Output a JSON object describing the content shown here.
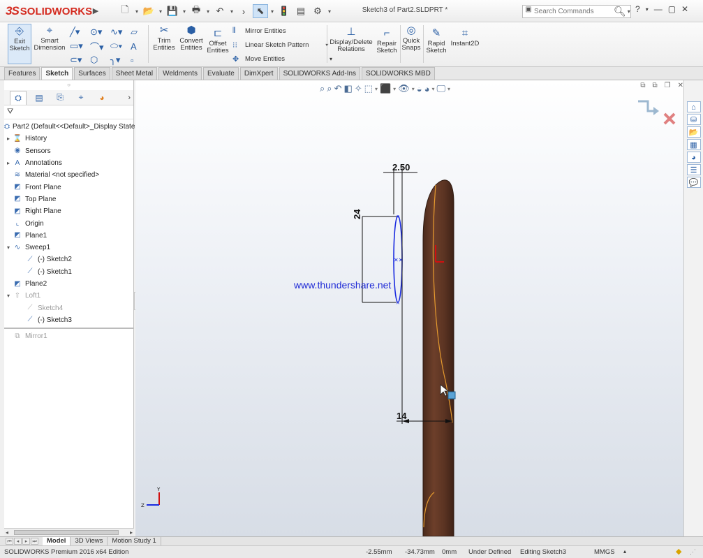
{
  "app": {
    "brand_ds": "3S",
    "brand_name": "SOLIDWORKS",
    "document_title": "Sketch3 of Part2.SLDPRT *",
    "search_placeholder": "Search Commands"
  },
  "command_manager": {
    "exit_sketch": [
      "Exit",
      "Sketch"
    ],
    "smart_dimension": [
      "Smart",
      "Dimension"
    ],
    "trim_entities": [
      "Trim",
      "Entities"
    ],
    "convert_entities": [
      "Convert",
      "Entities"
    ],
    "offset_entities": [
      "Offset",
      "Entities"
    ],
    "mirror_entities": "Mirror Entities",
    "linear_sketch_pattern": "Linear Sketch Pattern",
    "move_entities": "Move Entities",
    "display_delete_relations": [
      "Display/Delete",
      "Relations"
    ],
    "repair_sketch": [
      "Repair",
      "Sketch"
    ],
    "quick_snaps": [
      "Quick",
      "Snaps"
    ],
    "rapid_sketch": [
      "Rapid",
      "Sketch"
    ],
    "instant2d": "Instant2D"
  },
  "tabs": [
    "Features",
    "Sketch",
    "Surfaces",
    "Sheet Metal",
    "Weldments",
    "Evaluate",
    "DimXpert",
    "SOLIDWORKS Add-Ins",
    "SOLIDWORKS MBD"
  ],
  "active_tab": "Sketch",
  "feature_tree": {
    "root": "Part2  (Default<<Default>_Display State",
    "nodes": [
      {
        "label": "History",
        "icon": "history-icon",
        "expander": "▸",
        "indent": 0,
        "dim": false
      },
      {
        "label": "Sensors",
        "icon": "sensors-icon",
        "expander": "",
        "indent": 0,
        "dim": false
      },
      {
        "label": "Annotations",
        "icon": "annotations-icon",
        "expander": "▸",
        "indent": 0,
        "dim": false
      },
      {
        "label": "Material <not specified>",
        "icon": "material-icon",
        "expander": "",
        "indent": 0,
        "dim": false
      },
      {
        "label": "Front Plane",
        "icon": "plane-icon",
        "expander": "",
        "indent": 0,
        "dim": false
      },
      {
        "label": "Top Plane",
        "icon": "plane-icon",
        "expander": "",
        "indent": 0,
        "dim": false
      },
      {
        "label": "Right Plane",
        "icon": "plane-icon",
        "expander": "",
        "indent": 0,
        "dim": false
      },
      {
        "label": "Origin",
        "icon": "origin-icon",
        "expander": "",
        "indent": 0,
        "dim": false
      },
      {
        "label": "Plane1",
        "icon": "plane-icon",
        "expander": "",
        "indent": 0,
        "dim": false
      },
      {
        "label": "Sweep1",
        "icon": "sweep-icon",
        "expander": "▾",
        "indent": 0,
        "dim": false
      },
      {
        "label": "(-) Sketch2",
        "icon": "sketch-icon",
        "expander": "",
        "indent": 1,
        "dim": false
      },
      {
        "label": "(-) Sketch1",
        "icon": "sketch-icon",
        "expander": "",
        "indent": 1,
        "dim": false
      },
      {
        "label": "Plane2",
        "icon": "plane-icon",
        "expander": "",
        "indent": 0,
        "dim": false
      },
      {
        "label": "Loft1",
        "icon": "loft-icon",
        "expander": "▾",
        "indent": 0,
        "dim": true
      },
      {
        "label": "Sketch4",
        "icon": "sketch-icon",
        "expander": "",
        "indent": 1,
        "dim": true
      },
      {
        "label": "(-) Sketch3",
        "icon": "sketch-icon",
        "expander": "",
        "indent": 1,
        "dim": false
      }
    ],
    "after_divider": {
      "label": "Mirror1",
      "icon": "mirror-icon",
      "dim": true
    }
  },
  "viewport": {
    "watermark": "www.thundershare.net",
    "dim_top": "2.50",
    "dim_left": "24",
    "dim_bottom": "14",
    "triad_y": "Y",
    "triad_z": "Z"
  },
  "bottom_tabs": [
    "Model",
    "3D Views",
    "Motion Study 1"
  ],
  "active_bottom_tab": "Model",
  "status": {
    "edition": "SOLIDWORKS Premium 2016 x64 Edition",
    "x": "-2.55mm",
    "y": "-34.73mm",
    "z": "0mm",
    "state": "Under Defined",
    "editing": "Editing Sketch3",
    "units": "MMGS"
  }
}
